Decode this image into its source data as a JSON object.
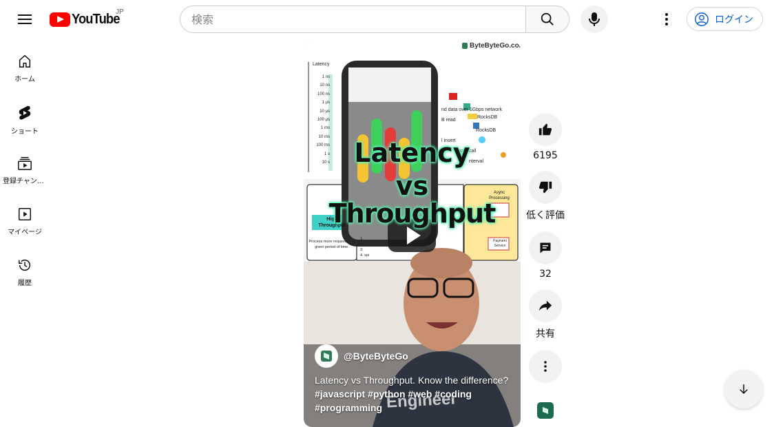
{
  "header": {
    "logo_text": "YouTube",
    "region": "JP",
    "search_placeholder": "検索",
    "login_label": "ログイン"
  },
  "sidebar": {
    "items": [
      {
        "label": "ホーム",
        "icon": "home-icon"
      },
      {
        "label": "ショート",
        "icon": "shorts-icon"
      },
      {
        "label": "登録チャンネル",
        "icon": "subscriptions-icon"
      },
      {
        "label": "マイページ",
        "icon": "you-icon"
      },
      {
        "label": "履歴",
        "icon": "history-icon"
      }
    ]
  },
  "video": {
    "watermark": "ByteByteGo.com",
    "overlay_title_line1": "Latency",
    "overlay_title_line2": "vs",
    "overlay_title_line3": "Throughput",
    "channel": "@ByteByteGo",
    "description_line1": "Latency vs Throughput. Know the difference?",
    "description_line2": "#javascript #python #web #coding",
    "description_line3": "#programming",
    "slide_latency_label": "Latency",
    "slide_high_throughput": "High Throughput",
    "slide_process_text": "Process more requests in a given period of time.",
    "slide_async": "Async Processing",
    "slide_rocksdb": "RocksDB",
    "slide_payment": "Payment Service",
    "shirt_text": "Engineer",
    "latency_ticks": [
      "1 ns",
      "10 ns",
      "100 ns",
      "1 μs",
      "10 μs",
      "100 μs",
      "1 ms",
      "10 ms",
      "100 ms",
      "1 s",
      "10 s"
    ],
    "latency_notes": [
      "nd data over 1Gbps network",
      "B read",
      "RocksDB",
      "l insert",
      "Zoom call",
      "nterval"
    ],
    "throughput_items": [
      "1.",
      "2.",
      "3.",
      "4. spi"
    ]
  },
  "actions": {
    "like_count": "6195",
    "dislike_label": "低く評価",
    "comment_count": "32",
    "share_label": "共有"
  },
  "colors": {
    "brand_red": "#ff0000",
    "link_blue": "#065fd4",
    "accent_green": "#5cf0b0"
  }
}
